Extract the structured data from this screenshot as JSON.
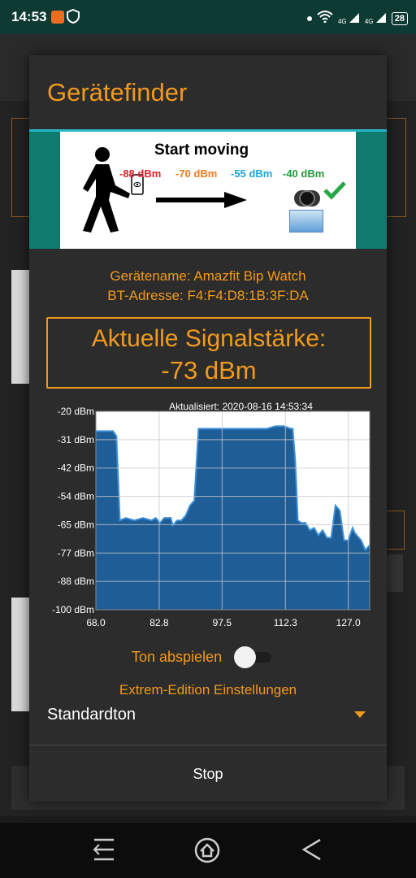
{
  "status_bar": {
    "time": "14:53",
    "battery": "28",
    "network_1": "4G",
    "network_2": "4G"
  },
  "dialog": {
    "title": "Gerätefinder",
    "banner": {
      "title": "Start moving",
      "dbm_values": [
        {
          "label": "-88 dBm",
          "color": "#e0202a"
        },
        {
          "label": "-70 dBm",
          "color": "#ee7a1c"
        },
        {
          "label": "-55 dBm",
          "color": "#20a4d8"
        },
        {
          "label": "-40 dBm",
          "color": "#1f9a3a"
        }
      ]
    },
    "device_name": "Gerätename: Amazfit Bip Watch",
    "bt_address": "BT-Adresse: F4:F4:D8:1B:3F:DA",
    "signal_label": "Aktuelle Signalstärke:",
    "signal_value": "-73 dBm",
    "toggle_label": "Ton abspielen",
    "toggle_on": false,
    "extreme_label": "Extrem-Edition Einstellungen",
    "sound_select": {
      "value": "Standardton"
    },
    "stop_label": "Stop"
  },
  "chart_data": {
    "type": "area",
    "title": "Aktualisiert: 2020-08-16 14:53:34",
    "color": "#1f5d96",
    "line_color": "#3b8fd8",
    "y_ticks": [
      "-20 dBm",
      "-31 dBm",
      "-42 dBm",
      "-54 dBm",
      "-65 dBm",
      "-77 dBm",
      "-88 dBm",
      "-100 dBm"
    ],
    "x_ticks": [
      "68.0",
      "82.8",
      "97.5",
      "112.3",
      "127.0"
    ],
    "xlim": [
      68.0,
      132.0
    ],
    "ylim": [
      -100,
      -20
    ],
    "grid": true,
    "x": [
      68.0,
      72.0,
      72.8,
      73.6,
      75.0,
      77.0,
      79.0,
      81.0,
      82.0,
      83.0,
      84.0,
      85.5,
      86.0,
      87.0,
      88.0,
      89.0,
      90.0,
      91.0,
      92.0,
      93.5,
      95.0,
      97.5,
      100.0,
      103.0,
      106.0,
      108.0,
      110.0,
      112.0,
      113.5,
      114.0,
      114.6,
      115.2,
      116.0,
      117.0,
      118.0,
      119.0,
      120.0,
      121.0,
      122.0,
      123.0,
      124.0,
      124.5,
      125.0,
      126.0,
      127.0,
      128.0,
      128.5,
      129.0,
      130.0,
      131.0,
      132.0
    ],
    "y": [
      -28,
      -28,
      -30,
      -64,
      -63,
      -64,
      -63,
      -64,
      -63,
      -65,
      -63,
      -63,
      -66,
      -64,
      -64,
      -62,
      -58,
      -56,
      -27,
      -27,
      -27,
      -27,
      -27,
      -27,
      -27,
      -27,
      -26,
      -26,
      -27,
      -27,
      -40,
      -64,
      -65,
      -65,
      -68,
      -67,
      -70,
      -68,
      -71,
      -71,
      -58,
      -59,
      -60,
      -72,
      -72,
      -67,
      -69,
      -70,
      -72,
      -76,
      -74
    ]
  },
  "nav": {
    "menu": "menu-icon",
    "home": "home-icon",
    "back": "back-icon"
  }
}
